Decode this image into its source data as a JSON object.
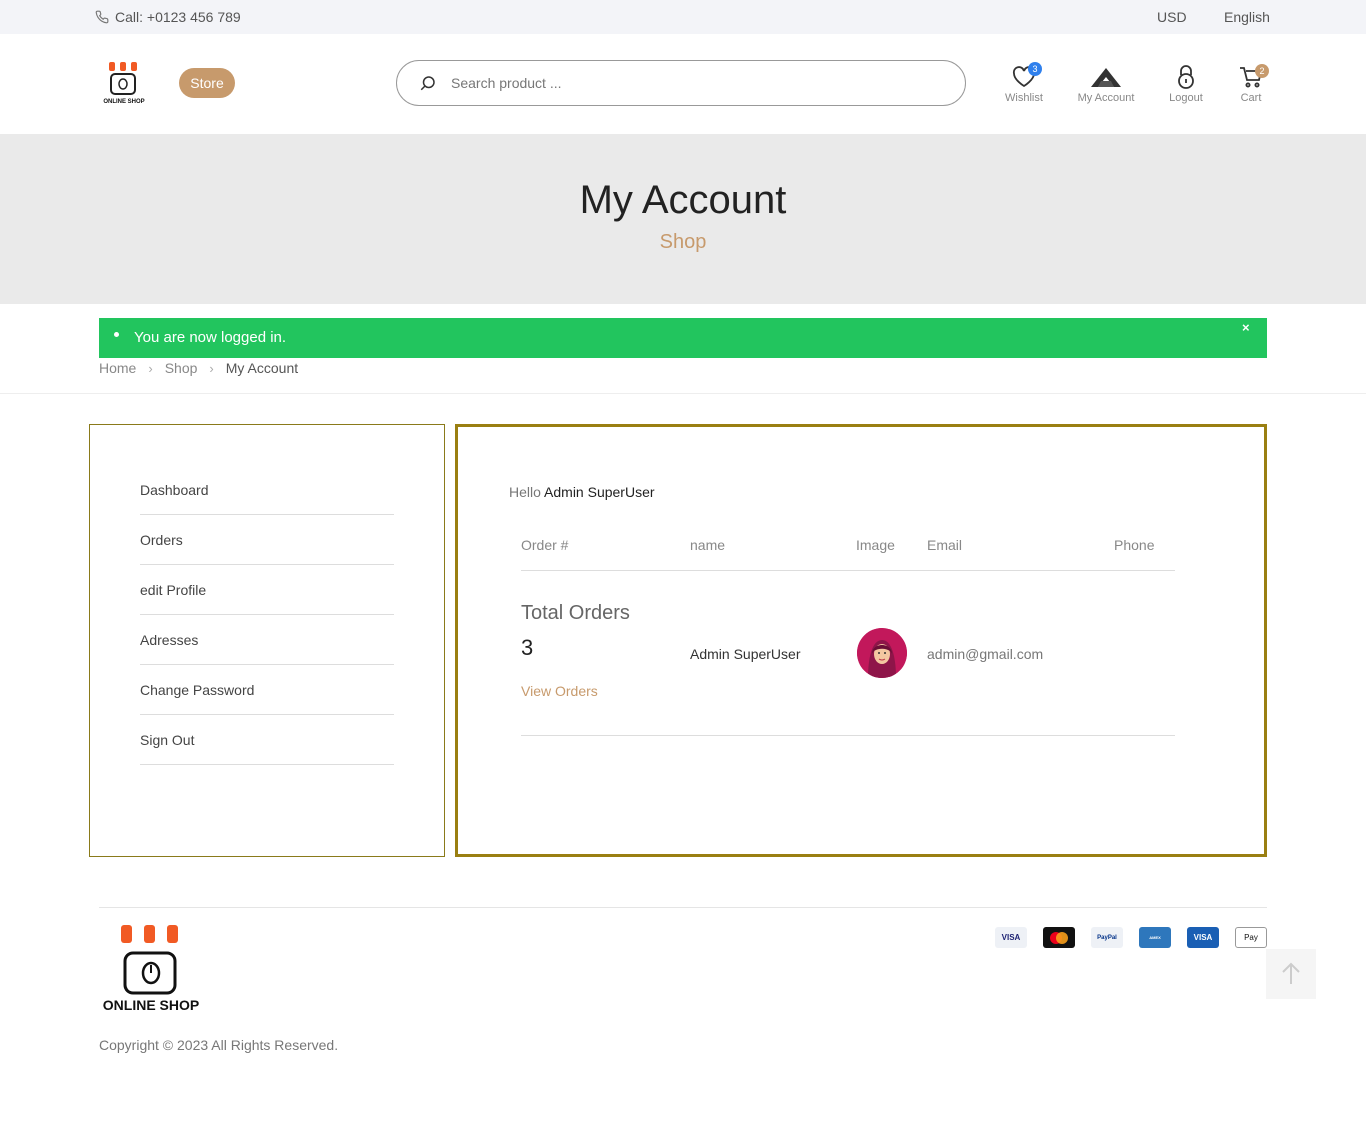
{
  "topbar": {
    "call": "Call: +0123 456 789",
    "currency": "USD",
    "language": "English"
  },
  "header": {
    "logo_text": "ONLINE SHOP",
    "store_label": "Store",
    "search_placeholder": "Search product ...",
    "wishlist": {
      "label": "Wishlist",
      "count": "3"
    },
    "account": {
      "label": "My Account"
    },
    "logout": {
      "label": "Logout"
    },
    "cart": {
      "label": "Cart",
      "count": "2"
    }
  },
  "banner": {
    "title": "My Account",
    "subtitle": "Shop"
  },
  "alert": {
    "message": "You are now logged in.",
    "close": "×"
  },
  "breadcrumb": {
    "home": "Home",
    "shop": "Shop",
    "current": "My Account",
    "separator": ">"
  },
  "sidebar": {
    "items": [
      {
        "label": "Dashboard"
      },
      {
        "label": "Orders"
      },
      {
        "label": "edit Profile"
      },
      {
        "label": "Adresses"
      },
      {
        "label": "Change Password"
      },
      {
        "label": "Sign Out"
      }
    ]
  },
  "dashboard": {
    "hello": "Hello",
    "user": "Admin SuperUser",
    "columns": {
      "order": "Order #",
      "name": "name",
      "image": "Image",
      "email": "Email",
      "phone": "Phone"
    },
    "row": {
      "total_label": "Total Orders",
      "total_count": "3",
      "view_orders": "View Orders",
      "name": "Admin SuperUser",
      "email": "admin@gmail.com",
      "phone": ""
    }
  },
  "footer": {
    "logo_text": "ONLINE SHOP",
    "copyright": "Copyright © 2023 All Rights Reserved.",
    "payments": [
      "VISA",
      "mastercard",
      "PayPal",
      "AMERICAN EXPRESS",
      "VISA Electron",
      "Apple Pay"
    ]
  },
  "colors": {
    "accent": "#c79a6c",
    "alert": "#22c55e",
    "panel_border": "#9a7f12",
    "badge_blue": "#2f80ed"
  }
}
